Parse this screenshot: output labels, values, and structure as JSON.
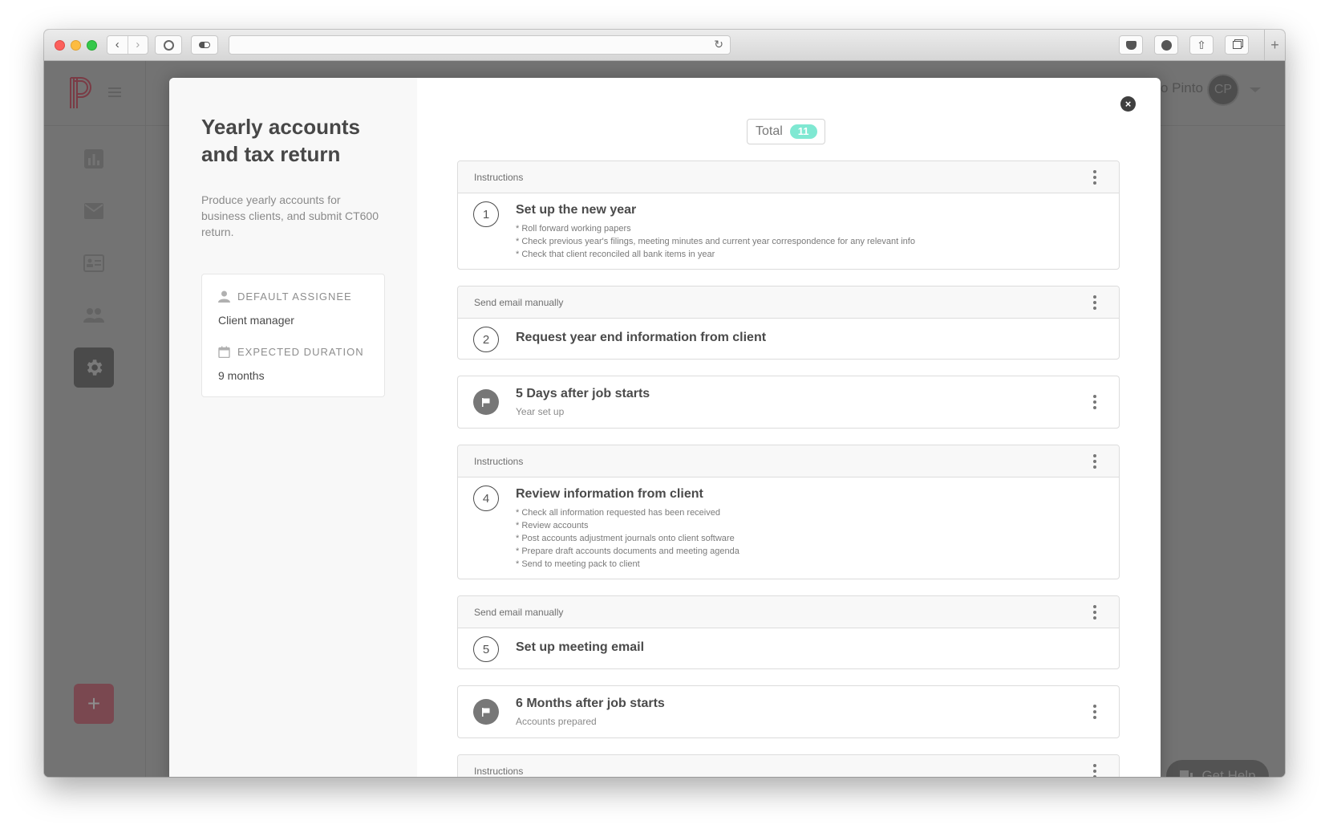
{
  "browser": {
    "url": "",
    "buttons": [
      "back",
      "forward",
      "1password",
      "toggle",
      "pocket",
      "download",
      "share",
      "tabs",
      "new-tab"
    ]
  },
  "app": {
    "user": {
      "name": "o Pinto",
      "initials": "CP"
    },
    "sidebar": {
      "items": [
        {
          "name": "dashboard",
          "icon": "bar-chart-icon",
          "active": false
        },
        {
          "name": "messages",
          "icon": "envelope-icon",
          "active": false
        },
        {
          "name": "clients",
          "icon": "contact-card-icon",
          "active": false
        },
        {
          "name": "team",
          "icon": "people-icon",
          "active": false
        },
        {
          "name": "settings",
          "icon": "gear-icon",
          "active": true
        }
      ],
      "add_label": "+"
    },
    "help_label": "Get Help",
    "colors": {
      "brand": "#b0283c",
      "accent_teal": "#7fe8d2"
    }
  },
  "modal": {
    "title": "Yearly accounts and tax return",
    "description": "Produce yearly accounts for business clients, and submit CT600 return.",
    "default_assignee_label": "DEFAULT ASSIGNEE",
    "default_assignee_value": "Client manager",
    "expected_duration_label": "EXPECTED DURATION",
    "expected_duration_value": "9 months",
    "close_label": "×",
    "total_label": "Total",
    "total_count": "11",
    "steps": [
      {
        "type": "task",
        "header": "Instructions",
        "number": "1",
        "title": "Set up the new year",
        "lines": [
          "* Roll forward working papers",
          "* Check previous year's filings, meeting minutes and current year correspondence for any relevant info",
          "* Check that client reconciled all bank items in year"
        ]
      },
      {
        "type": "task",
        "header": "Send email manually",
        "number": "2",
        "title": "Request year end information from client",
        "lines": []
      },
      {
        "type": "milestone",
        "title": "5 Days after job starts",
        "subtitle": "Year set up"
      },
      {
        "type": "task",
        "header": "Instructions",
        "number": "4",
        "title": "Review information from client",
        "lines": [
          "* Check all information requested has been received",
          "* Review accounts",
          "* Post accounts adjustment journals onto client software",
          "* Prepare draft accounts documents and meeting agenda",
          "* Send to meeting pack to client"
        ]
      },
      {
        "type": "task",
        "header": "Send email manually",
        "number": "5",
        "title": "Set up meeting email",
        "lines": []
      },
      {
        "type": "milestone",
        "title": "6 Months after job starts",
        "subtitle": "Accounts prepared"
      },
      {
        "type": "task",
        "header": "Instructions",
        "number": "",
        "title": "",
        "lines": []
      }
    ]
  }
}
